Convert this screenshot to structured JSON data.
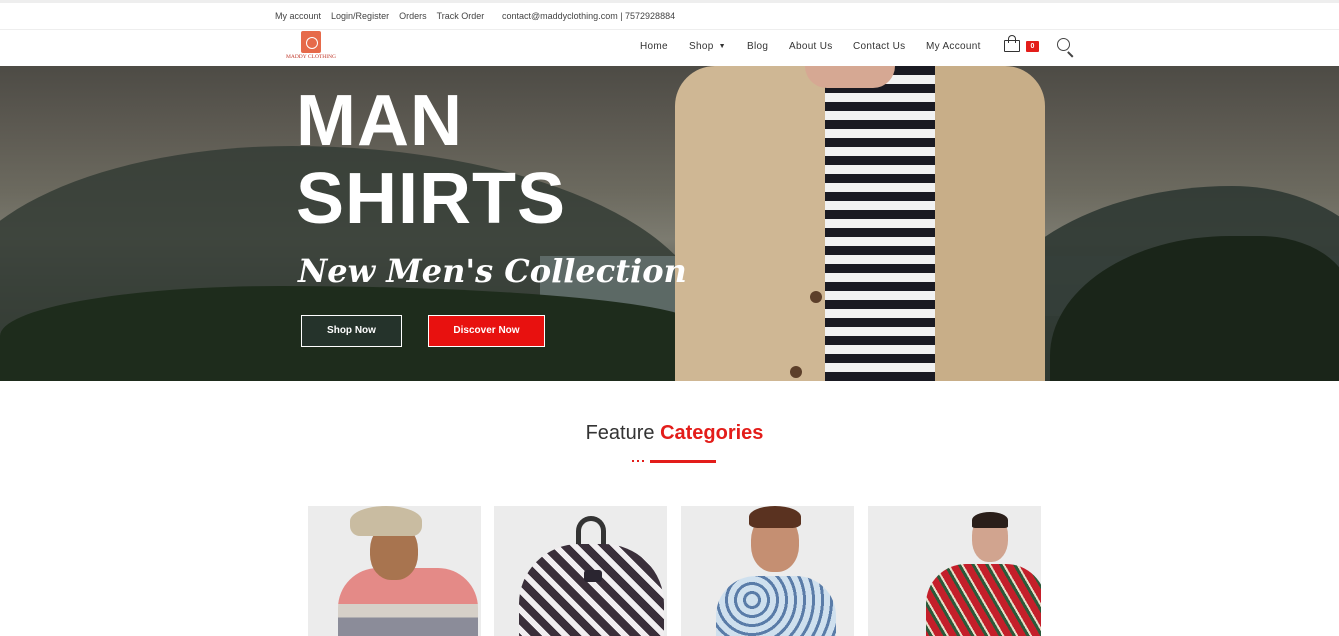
{
  "topbar": {
    "links": [
      "My account",
      "Login/Register",
      "Orders",
      "Track Order"
    ],
    "contact": "contact@maddyclothing.com | 7572928884"
  },
  "header": {
    "logo_text": "MADDY CLOTHING",
    "nav": [
      {
        "label": "Home"
      },
      {
        "label": "Shop",
        "has_dropdown": true
      },
      {
        "label": "Blog"
      },
      {
        "label": "About Us"
      },
      {
        "label": "Contact Us"
      },
      {
        "label": "My Account"
      }
    ],
    "cart_count": "0"
  },
  "hero": {
    "title_line1": "MAN",
    "title_line2": "SHIRTS",
    "subtitle": "New Men's Collection",
    "button_primary": "Shop Now",
    "button_secondary": "Discover Now"
  },
  "features": {
    "heading_plain": "Feature",
    "heading_accent": "Categories",
    "cards": [
      {
        "icon": "polo-shirt-model"
      },
      {
        "icon": "patterned-backpack"
      },
      {
        "icon": "printed-shirt-model"
      },
      {
        "icon": "floral-blazer-model"
      }
    ]
  },
  "colors": {
    "accent": "#e31d1a",
    "text": "#333333"
  }
}
